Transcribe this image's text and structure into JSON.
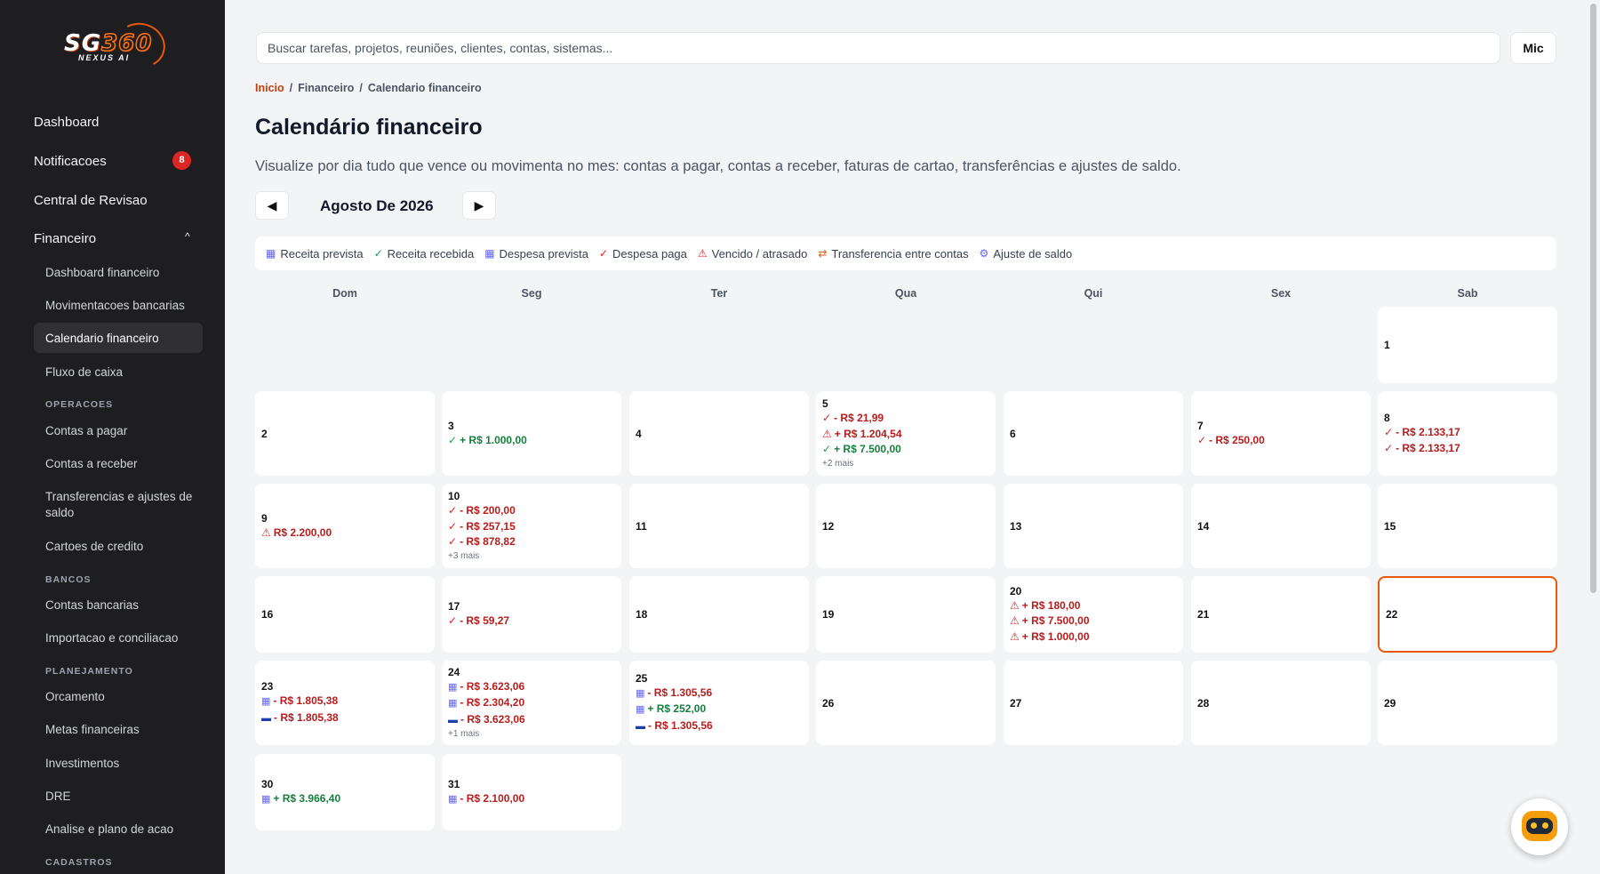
{
  "sidebar": {
    "logo": {
      "main": "SG",
      "num": "360",
      "sub": "NEXUS AI"
    },
    "nav": [
      {
        "label": "Dashboard"
      },
      {
        "label": "Notificacoes",
        "badge": "8"
      },
      {
        "label": "Central de Revisao"
      },
      {
        "label": "Financeiro",
        "expanded": true
      }
    ],
    "financeiro_items": [
      "Dashboard financeiro",
      "Movimentacoes bancarias",
      "Calendario financeiro",
      "Fluxo de caixa"
    ],
    "sections": [
      {
        "title": "OPERACOES",
        "items": [
          "Contas a pagar",
          "Contas a receber",
          "Transferencias e ajustes de saldo",
          "Cartoes de credito"
        ]
      },
      {
        "title": "BANCOS",
        "items": [
          "Contas bancarias",
          "Importacao e conciliacao"
        ]
      },
      {
        "title": "PLANEJAMENTO",
        "items": [
          "Orcamento",
          "Metas financeiras",
          "Investimentos",
          "DRE",
          "Analise e plano de acao"
        ]
      },
      {
        "title": "CADASTROS",
        "items": []
      }
    ],
    "active_item": "Calendario financeiro"
  },
  "header": {
    "search_placeholder": "Buscar tarefas, projetos, reuniões, clientes, contas, sistemas...",
    "mic_label": "Mic"
  },
  "breadcrumb": [
    "Inicio",
    "Financeiro",
    "Calendario financeiro"
  ],
  "page": {
    "title": "Calendário financeiro",
    "description": "Visualize por dia tudo que vence ou movimenta no mes: contas a pagar, contas a receber, faturas de cartao, transferências e ajustes de saldo.",
    "month_label": "Agosto De 2026",
    "prev_icon": "◀",
    "next_icon": "▶"
  },
  "legend": [
    {
      "icon": "calendar-icon",
      "glyph": "▦",
      "label": "Receita prevista",
      "color": "#6366f1"
    },
    {
      "icon": "check-icon",
      "glyph": "✓",
      "label": "Receita recebida",
      "color": "#16a34a"
    },
    {
      "icon": "calendar-icon",
      "glyph": "▦",
      "label": "Despesa prevista",
      "color": "#6366f1"
    },
    {
      "icon": "check-icon",
      "glyph": "✓",
      "label": "Despesa paga",
      "color": "#dc2626"
    },
    {
      "icon": "warning-icon",
      "glyph": "⚠",
      "label": "Vencido / atrasado",
      "color": "#dc2626"
    },
    {
      "icon": "transfer-icon",
      "glyph": "⇄",
      "label": "Transferencia entre contas",
      "color": "#ea580c"
    },
    {
      "icon": "adjust-icon",
      "glyph": "⚙",
      "label": "Ajuste de saldo",
      "color": "#6366f1"
    }
  ],
  "weekdays": [
    "Dom",
    "Seg",
    "Ter",
    "Qua",
    "Qui",
    "Sex",
    "Sab"
  ],
  "today": "22",
  "weeks": [
    [
      null,
      null,
      null,
      null,
      null,
      null,
      {
        "day": "1",
        "entries": []
      }
    ],
    [
      {
        "day": "2",
        "entries": []
      },
      {
        "day": "3",
        "entries": [
          {
            "icon": "check",
            "text": "+ R$ 1.000,00",
            "type": "pos"
          }
        ]
      },
      {
        "day": "4",
        "entries": []
      },
      {
        "day": "5",
        "entries": [
          {
            "icon": "check",
            "text": "- R$ 21,99",
            "type": "neg"
          },
          {
            "icon": "warn",
            "text": "+ R$ 1.204,54",
            "type": "neg"
          },
          {
            "icon": "check",
            "text": "+ R$ 7.500,00",
            "type": "pos"
          }
        ],
        "more": "+2 mais"
      },
      {
        "day": "6",
        "entries": []
      },
      {
        "day": "7",
        "entries": [
          {
            "icon": "check",
            "text": "- R$ 250,00",
            "type": "neg"
          }
        ]
      },
      {
        "day": "8",
        "entries": [
          {
            "icon": "check",
            "text": "- R$ 2.133,17",
            "type": "neg"
          },
          {
            "icon": "check",
            "text": "- R$ 2.133,17",
            "type": "neg"
          }
        ]
      }
    ],
    [
      {
        "day": "9",
        "entries": [
          {
            "icon": "warn",
            "text": "R$ 2.200,00",
            "type": "neg"
          }
        ]
      },
      {
        "day": "10",
        "entries": [
          {
            "icon": "check",
            "text": "- R$ 200,00",
            "type": "neg"
          },
          {
            "icon": "check",
            "text": "- R$ 257,15",
            "type": "neg"
          },
          {
            "icon": "check",
            "text": "- R$ 878,82",
            "type": "neg"
          }
        ],
        "more": "+3 mais"
      },
      {
        "day": "11",
        "entries": []
      },
      {
        "day": "12",
        "entries": []
      },
      {
        "day": "13",
        "entries": []
      },
      {
        "day": "14",
        "entries": []
      },
      {
        "day": "15",
        "entries": []
      }
    ],
    [
      {
        "day": "16",
        "entries": []
      },
      {
        "day": "17",
        "entries": [
          {
            "icon": "check",
            "text": "- R$ 59,27",
            "type": "neg"
          }
        ]
      },
      {
        "day": "18",
        "entries": []
      },
      {
        "day": "19",
        "entries": []
      },
      {
        "day": "20",
        "entries": [
          {
            "icon": "warn",
            "text": "+ R$ 180,00",
            "type": "neg"
          },
          {
            "icon": "warn",
            "text": "+ R$ 7.500,00",
            "type": "neg"
          },
          {
            "icon": "warn",
            "text": "+ R$ 1.000,00",
            "type": "neg"
          }
        ]
      },
      {
        "day": "21",
        "entries": []
      },
      {
        "day": "22",
        "entries": []
      }
    ],
    [
      {
        "day": "23",
        "entries": [
          {
            "icon": "cal",
            "text": "- R$ 1.805,38",
            "type": "neg"
          },
          {
            "icon": "card",
            "text": "- R$ 1.805,38",
            "type": "neg"
          }
        ]
      },
      {
        "day": "24",
        "entries": [
          {
            "icon": "cal",
            "text": "- R$ 3.623,06",
            "type": "neg"
          },
          {
            "icon": "cal",
            "text": "- R$ 2.304,20",
            "type": "neg"
          },
          {
            "icon": "card",
            "text": "- R$ 3.623,06",
            "type": "neg"
          }
        ],
        "more": "+1 mais"
      },
      {
        "day": "25",
        "entries": [
          {
            "icon": "cal",
            "text": "- R$ 1.305,56",
            "type": "neg"
          },
          {
            "icon": "cal",
            "text": "+ R$ 252,00",
            "type": "pos"
          },
          {
            "icon": "card",
            "text": "- R$ 1.305,56",
            "type": "neg"
          }
        ]
      },
      {
        "day": "26",
        "entries": []
      },
      {
        "day": "27",
        "entries": []
      },
      {
        "day": "28",
        "entries": []
      },
      {
        "day": "29",
        "entries": []
      }
    ],
    [
      {
        "day": "30",
        "entries": [
          {
            "icon": "cal",
            "text": "+ R$ 3.966,40",
            "type": "pos"
          }
        ]
      },
      {
        "day": "31",
        "entries": [
          {
            "icon": "cal",
            "text": "- R$ 2.100,00",
            "type": "neg"
          }
        ]
      },
      null,
      null,
      null,
      null,
      null
    ]
  ],
  "colors": {
    "accent": "#ea580c",
    "negative": "#b91c1c",
    "positive": "#15803d",
    "sidebar_bg": "#1e1e21"
  }
}
